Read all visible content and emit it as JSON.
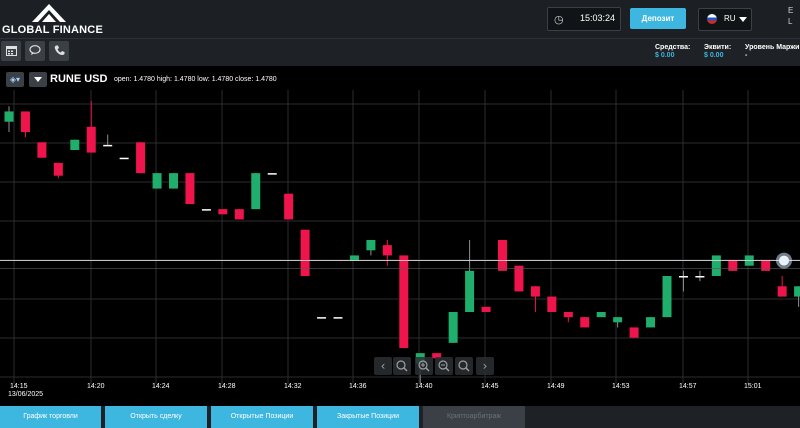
{
  "header": {
    "logo_text": "GLOBAL FINANCE",
    "clock_icon": "clock-icon",
    "clock": "15:03:24",
    "deposit_label": "Депозит",
    "lang_code": "RU",
    "edge_top": "E",
    "edge_bottom": "L"
  },
  "toolbar": {
    "icons": [
      "calendar-icon",
      "chat-icon",
      "phone-icon"
    ]
  },
  "account": {
    "funds_label": "Средства:",
    "funds_value": "$ 0.00",
    "equity_label": "Эквити:",
    "equity_value": "$ 0.00",
    "margin_label": "Уровень Маржи",
    "margin_value": "-"
  },
  "chart": {
    "symbol": "RUNE USD",
    "ohlc": "open: 1.4780  high: 1.4780  low: 1.4780  close: 1.4780",
    "nav_icons": [
      "arrow-left-icon",
      "zoom-reset-icon",
      "zoom-in-icon",
      "zoom-out-icon",
      "zoom-search-icon",
      "arrow-right-icon"
    ]
  },
  "chart_data": {
    "type": "candlestick",
    "x_ticks": [
      "14:15",
      "14:20",
      "14:24",
      "14:28",
      "14:32",
      "14:36",
      "14:40",
      "14:45",
      "14:49",
      "14:53",
      "14:57",
      "15:01"
    ],
    "x_date": "13/06/2025",
    "up_color": "#1fae6b",
    "down_color": "#f0144c",
    "crosshair_price": 1.478,
    "candles": [
      {
        "o": 1.532,
        "h": 1.538,
        "l": 1.528,
        "c": 1.536
      },
      {
        "o": 1.536,
        "h": 1.536,
        "l": 1.526,
        "c": 1.528
      },
      {
        "o": 1.524,
        "h": 1.524,
        "l": 1.518,
        "c": 1.518
      },
      {
        "o": 1.516,
        "h": 1.516,
        "l": 1.51,
        "c": 1.511
      },
      {
        "o": 1.521,
        "h": 1.525,
        "l": 1.521,
        "c": 1.525
      },
      {
        "o": 1.53,
        "h": 1.54,
        "l": 1.522,
        "c": 1.52
      },
      {
        "o": 1.523,
        "h": 1.527,
        "l": 1.523,
        "c": 1.523
      },
      {
        "o": 1.518,
        "h": 1.518,
        "l": 1.518,
        "c": 1.518
      },
      {
        "o": 1.524,
        "h": 1.524,
        "l": 1.512,
        "c": 1.512
      },
      {
        "o": 1.506,
        "h": 1.512,
        "l": 1.506,
        "c": 1.512
      },
      {
        "o": 1.506,
        "h": 1.512,
        "l": 1.506,
        "c": 1.512
      },
      {
        "o": 1.512,
        "h": 1.512,
        "l": 1.5,
        "c": 1.5
      },
      {
        "o": 1.498,
        "h": 1.498,
        "l": 1.498,
        "c": 1.498
      },
      {
        "o": 1.498,
        "h": 1.498,
        "l": 1.496,
        "c": 1.496
      },
      {
        "o": 1.498,
        "h": 1.498,
        "l": 1.494,
        "c": 1.494
      },
      {
        "o": 1.498,
        "h": 1.512,
        "l": 1.498,
        "c": 1.512
      },
      {
        "o": 1.512,
        "h": 1.512,
        "l": 1.512,
        "c": 1.512
      },
      {
        "o": 1.504,
        "h": 1.504,
        "l": 1.494,
        "c": 1.494
      },
      {
        "o": 1.49,
        "h": 1.49,
        "l": 1.472,
        "c": 1.472
      },
      {
        "o": 1.456,
        "h": 1.456,
        "l": 1.456,
        "c": 1.456
      },
      {
        "o": 1.456,
        "h": 1.456,
        "l": 1.456,
        "c": 1.456
      },
      {
        "o": 1.478,
        "h": 1.48,
        "l": 1.478,
        "c": 1.48
      },
      {
        "o": 1.482,
        "h": 1.486,
        "l": 1.48,
        "c": 1.486
      },
      {
        "o": 1.484,
        "h": 1.486,
        "l": 1.476,
        "c": 1.48
      },
      {
        "o": 1.48,
        "h": 1.48,
        "l": 1.444,
        "c": 1.444
      },
      {
        "o": 1.438,
        "h": 1.442,
        "l": 1.43,
        "c": 1.442
      },
      {
        "o": 1.442,
        "h": 1.442,
        "l": 1.44,
        "c": 1.44
      },
      {
        "o": 1.446,
        "h": 1.458,
        "l": 1.446,
        "c": 1.458
      },
      {
        "o": 1.458,
        "h": 1.486,
        "l": 1.458,
        "c": 1.474
      },
      {
        "o": 1.46,
        "h": 1.46,
        "l": 1.458,
        "c": 1.458
      },
      {
        "o": 1.486,
        "h": 1.486,
        "l": 1.474,
        "c": 1.474
      },
      {
        "o": 1.476,
        "h": 1.476,
        "l": 1.466,
        "c": 1.466
      },
      {
        "o": 1.468,
        "h": 1.468,
        "l": 1.458,
        "c": 1.464
      },
      {
        "o": 1.464,
        "h": 1.464,
        "l": 1.458,
        "c": 1.458
      },
      {
        "o": 1.458,
        "h": 1.458,
        "l": 1.454,
        "c": 1.456
      },
      {
        "o": 1.456,
        "h": 1.456,
        "l": 1.452,
        "c": 1.452
      },
      {
        "o": 1.456,
        "h": 1.458,
        "l": 1.456,
        "c": 1.458
      },
      {
        "o": 1.454,
        "h": 1.456,
        "l": 1.452,
        "c": 1.456
      },
      {
        "o": 1.452,
        "h": 1.452,
        "l": 1.448,
        "c": 1.448
      },
      {
        "o": 1.452,
        "h": 1.456,
        "l": 1.452,
        "c": 1.456
      },
      {
        "o": 1.456,
        "h": 1.472,
        "l": 1.456,
        "c": 1.472
      },
      {
        "o": 1.472,
        "h": 1.474,
        "l": 1.466,
        "c": 1.472
      },
      {
        "o": 1.472,
        "h": 1.474,
        "l": 1.47,
        "c": 1.472
      },
      {
        "o": 1.472,
        "h": 1.48,
        "l": 1.472,
        "c": 1.48
      },
      {
        "o": 1.478,
        "h": 1.478,
        "l": 1.474,
        "c": 1.474
      },
      {
        "o": 1.476,
        "h": 1.48,
        "l": 1.476,
        "c": 1.48
      },
      {
        "o": 1.478,
        "h": 1.478,
        "l": 1.474,
        "c": 1.474
      },
      {
        "o": 1.468,
        "h": 1.472,
        "l": 1.464,
        "c": 1.464
      },
      {
        "o": 1.464,
        "h": 1.468,
        "l": 1.46,
        "c": 1.468
      }
    ]
  },
  "tabs": [
    {
      "label": "График торговли",
      "active": true
    },
    {
      "label": "Открыть сделку",
      "active": true
    },
    {
      "label": "Открытые Позиции",
      "active": true
    },
    {
      "label": "Закрытые Позиции",
      "active": true
    },
    {
      "label": "Криптоарбитраж",
      "active": false
    }
  ]
}
